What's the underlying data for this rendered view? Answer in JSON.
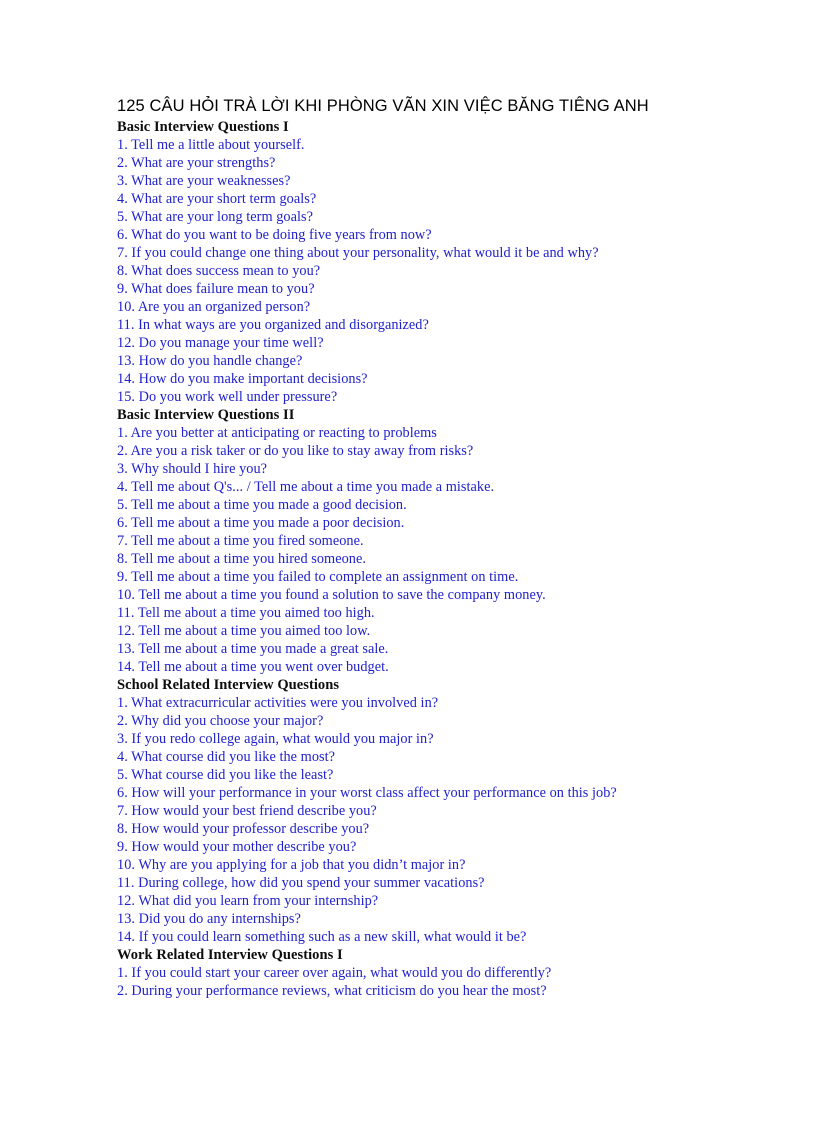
{
  "document": {
    "title_line1": "125 CÂU HỎI  TRÀ LỜI  KHI PHÒNG VÃN XIN VIỆC BĂNG",
    "title_line2": "TIÊNG ANH",
    "title_full": "125 CÂU HỎI  TRÀ LỜI  KHI PHÒNG VÃN XIN VIỆC BĂNG TIÊNG ANH",
    "text_color_body": "#2121cc",
    "text_color_heading": "#0d0d0d",
    "page_background": "#ffffff"
  },
  "sections": [
    {
      "heading": "Basic Interview Questions I",
      "questions": [
        "1. Tell me a little  about yourself.",
        "2. What are your strengths?",
        "3. What are your weaknesses?",
        "4. What are your short term goals?",
        "5. What are your long term goals?",
        "6. What do you want to be doing  five years from now?",
        "7. If you could  change one thing  about your personality,  what would  it be and why?",
        "8. What does success mean to you?",
        "9. What does failure  mean to you?",
        "10. Are you an organized person?",
        "11. In what ways are you  organized  and disorganized?",
        "12. Do you manage your time  well?",
        "13. How do you handle  change?",
        "14. How do you make important  decisions?",
        "15. Do you work well under pressure?"
      ]
    },
    {
      "heading": "Basic Interview Questions II",
      "questions": [
        "1. Are you better at anticipating  or reacting to problems",
        "2. Are you a risk taker or do you like  to stay away from risks?",
        "3. Why should  I hire you?",
        "4. Tell me about Q's... / Tell me about a time you made a mistake.",
        "5. Tell me about a time  you made a good  decision.",
        "6. Tell me about a time  you made a poor  decision.",
        "7. Tell me about a time  you fired  someone.",
        "8. Tell me about a time  you hired  someone.",
        "9. Tell me about a time  you failed to complete  an assignment  on time.",
        "10. Tell me about a time  you found  a solution  to save the company money.",
        "11. Tell me about a time  you aimed too  high.",
        "12. Tell me about a time  you aimed too  low.",
        "13. Tell me about a time  you made a great sale.",
        "14. Tell me about a time  you went over budget."
      ]
    },
    {
      "heading": "School Related Interview Questions",
      "questions": [
        "1. What extracurricular activities  were you involved  in?",
        "2. Why did  you choose your  major?",
        "3. If you redo college  again, what would  you major  in?",
        "4. What course did  you like  the most?",
        "5. What course did  you like  the least?",
        "6. How will  your performance in your worst class affect your performance on this job?",
        "7. How would  your best friend describe you?",
        "8. How would  your professor describe you?",
        "9. How would  your mother describe you?",
        "10. Why are you applying  for a job  that you didn’t  major in?",
        "11. During college,  how did  you spend your summer vacations?",
        "12. What did  you learn from your internship?",
        "13. Did  you do  any internships?",
        "14. If you could learn something  such as a new skill,  what would  it be?"
      ]
    },
    {
      "heading": "Work Related Interview Questions I",
      "questions": [
        "1. If you could  start your career over again, what would  you do differently?",
        "2. During your performance reviews,  what criticism  do  you hear the most?"
      ]
    }
  ]
}
